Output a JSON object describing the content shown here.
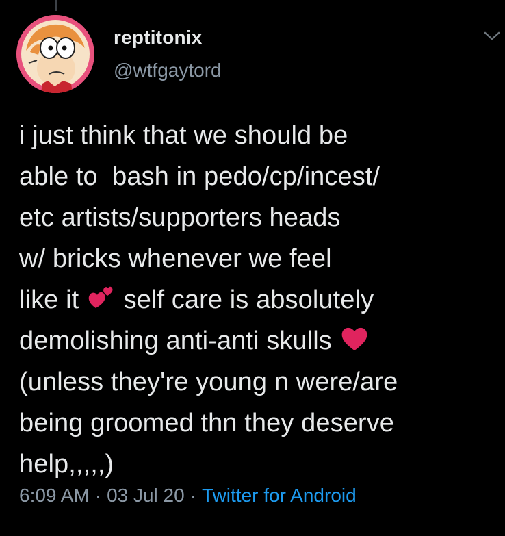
{
  "user": {
    "display_name": "reptitonix",
    "handle": "@wtfgaytord"
  },
  "tweet": {
    "lines": [
      "i just think that we should be",
      "able to  bash in pedo/cp/incest/",
      "etc artists/supporters heads",
      "w/ bricks whenever we feel",
      "like it ",
      " self care is absolutely",
      "demolishing anti-anti skulls ",
      "(unless they're young n were/are",
      "being groomed thn they deserve",
      "help,,,,,)"
    ],
    "emojis": [
      "two-hearts-icon",
      "red-heart-icon"
    ]
  },
  "meta": {
    "time": "6:09 AM",
    "separator": "·",
    "date": "03 Jul 20",
    "source": "Twitter for Android"
  },
  "colors": {
    "background": "#000000",
    "text": "#e7e9ea",
    "secondary": "#8b98a5",
    "link": "#1d9bf0",
    "heart": "#e0245e"
  }
}
